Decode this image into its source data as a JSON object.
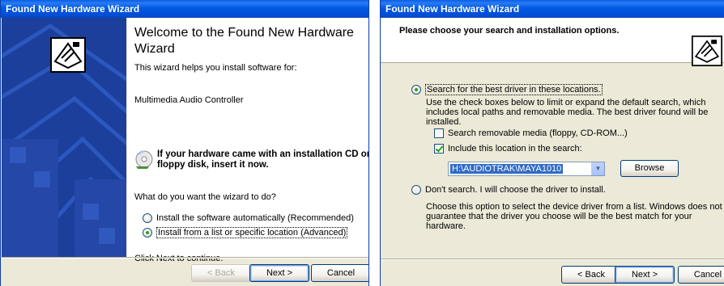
{
  "left_wizard": {
    "title": "Found New Hardware Wizard",
    "heading": "Welcome to the Found New Hardware Wizard",
    "intro": "This wizard helps you install software for:",
    "device": "Multimedia Audio Controller",
    "cd_prompt": "If your hardware came with an installation CD or floppy disk, insert it now.",
    "question": "What do you want the wizard to do?",
    "options": [
      {
        "label": "Install the software automatically (Recommended)",
        "selected": false
      },
      {
        "label": "Install from a list or specific location (Advanced)",
        "selected": true
      }
    ],
    "footer_note": "Click Next to continue.",
    "buttons": {
      "back": "< Back",
      "next": "Next >",
      "cancel": "Cancel"
    }
  },
  "right_wizard": {
    "title": "Found New Hardware Wizard",
    "header_title": "Please choose your search and installation options.",
    "option_search": {
      "label": "Search for the best driver in these locations.",
      "selected": true
    },
    "search_desc": "Use the check boxes below to limit or expand the default search, which includes local paths and removable media. The best driver found will be installed.",
    "checkbox_removable": {
      "label": "Search removable media (floppy, CD-ROM...)",
      "checked": false
    },
    "checkbox_location": {
      "label": "Include this location in the search:",
      "checked": true
    },
    "location_value": "H:\\AUDIOTRAK\\MAYA1010",
    "browse_label": "Browse",
    "option_dont_search": {
      "label": "Don't search. I will choose the driver to install.",
      "selected": false
    },
    "dont_search_desc": "Choose this option to select the device driver from a list.  Windows does not guarantee that the driver you choose will be the best match for your hardware.",
    "buttons": {
      "back": "< Back",
      "next": "Next >",
      "cancel": "Cancel"
    }
  }
}
